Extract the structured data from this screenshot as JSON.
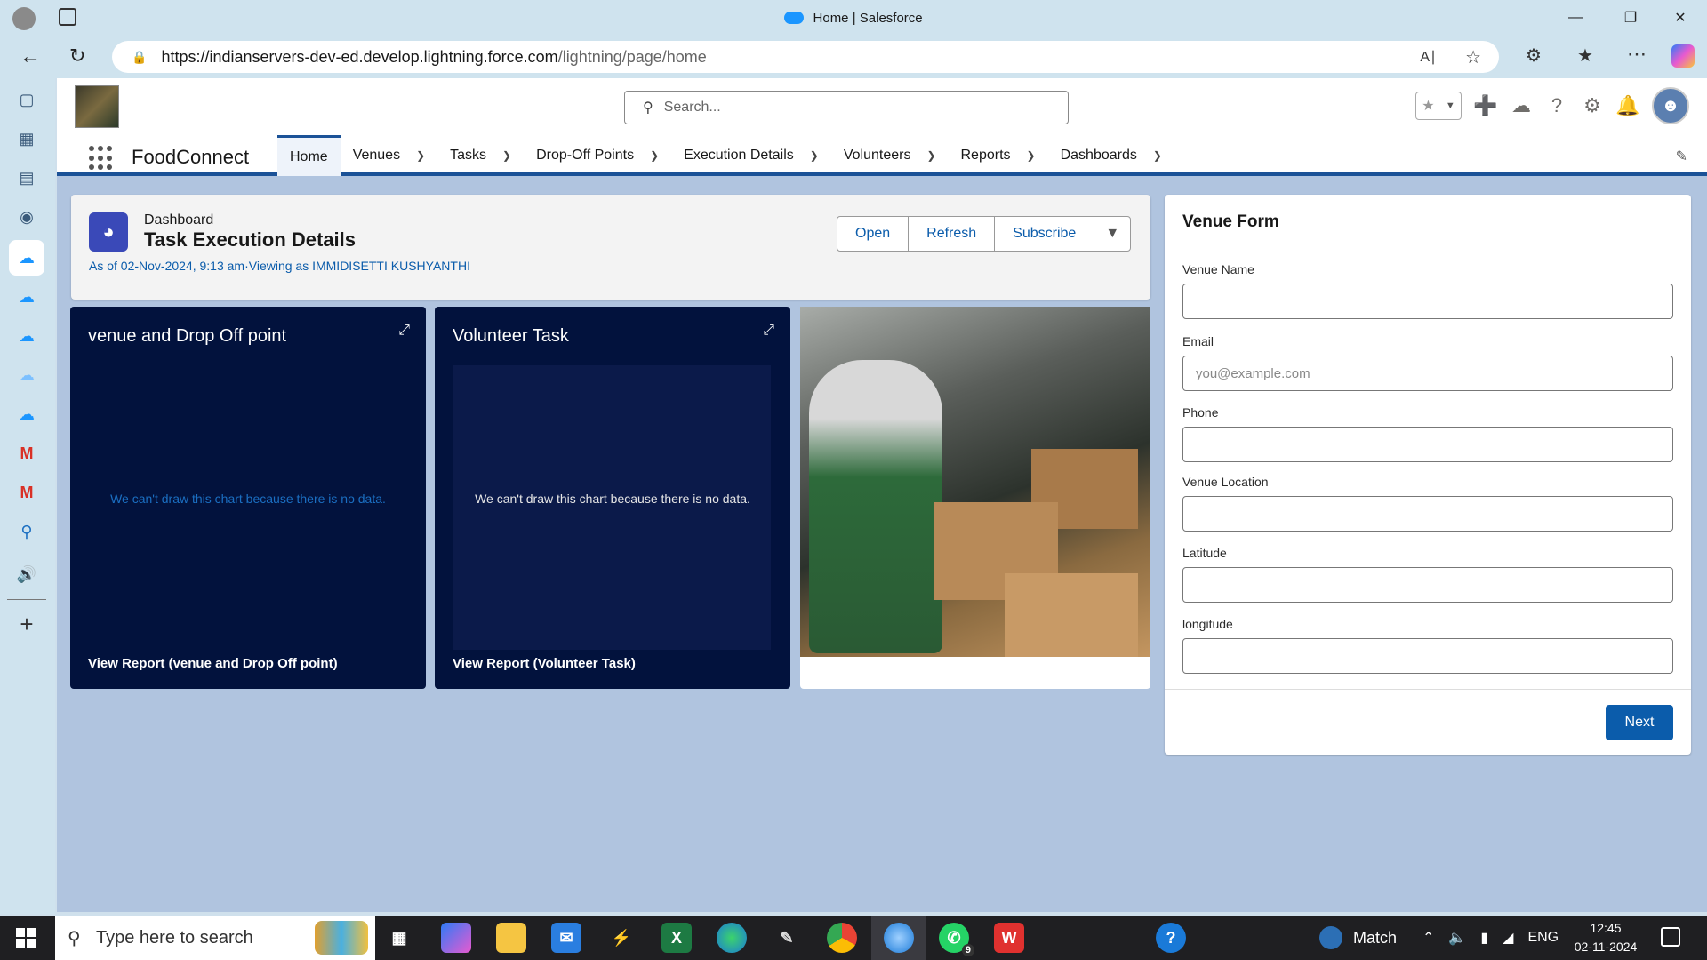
{
  "browser": {
    "tab_title": "Home | Salesforce",
    "url_host": "https://indianservers-dev-ed.develop.lightning.force.com",
    "url_path": "/lightning/page/home"
  },
  "header": {
    "search_placeholder": "Search..."
  },
  "nav": {
    "app_name": "FoodConnect",
    "tabs": [
      {
        "label": "Home"
      },
      {
        "label": "Venues"
      },
      {
        "label": "Tasks"
      },
      {
        "label": "Drop-Off Points"
      },
      {
        "label": "Execution Details"
      },
      {
        "label": "Volunteers"
      },
      {
        "label": "Reports"
      },
      {
        "label": "Dashboards"
      }
    ]
  },
  "dashboard": {
    "label": "Dashboard",
    "title": "Task Execution Details",
    "meta": "As of 02-Nov-2024, 9:13 am·Viewing as IMMIDISETTI KUSHYANTHI",
    "buttons": {
      "open": "Open",
      "refresh": "Refresh",
      "subscribe": "Subscribe"
    }
  },
  "cards": [
    {
      "title": "venue and Drop Off point",
      "nodata": "We can't draw this chart because there is no data.",
      "report": "View Report (venue and Drop Off point)"
    },
    {
      "title": "Volunteer Task",
      "nodata": "We can't draw this chart because there is no data.",
      "report": "View Report (Volunteer Task)"
    }
  ],
  "form": {
    "title": "Venue Form",
    "fields": [
      {
        "label": "Venue Name",
        "placeholder": ""
      },
      {
        "label": "Email",
        "placeholder": "you@example.com"
      },
      {
        "label": "Phone",
        "placeholder": ""
      },
      {
        "label": "Venue Location",
        "placeholder": ""
      },
      {
        "label": "Latitude",
        "placeholder": ""
      },
      {
        "label": "longitude",
        "placeholder": ""
      }
    ],
    "next": "Next"
  },
  "taskbar": {
    "search_placeholder": "Type here to search",
    "weather": "Match",
    "lang": "ENG",
    "time": "12:45",
    "date": "02-11-2024",
    "whatsapp_badge": "9"
  }
}
